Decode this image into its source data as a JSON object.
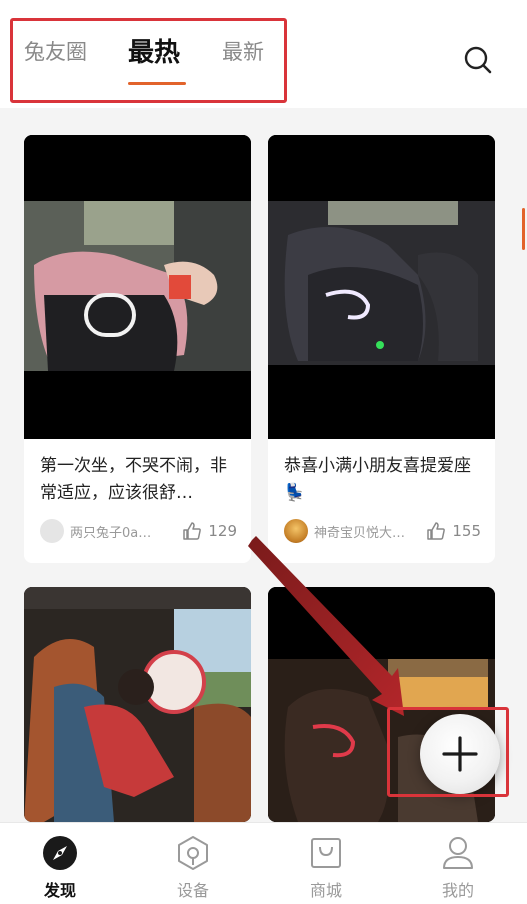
{
  "header": {
    "tabs": [
      {
        "label": "兔友圈",
        "active": false
      },
      {
        "label": "最热",
        "active": true
      },
      {
        "label": "最新",
        "active": false
      }
    ],
    "search_icon": "search-icon",
    "accent_color": "#e2632b"
  },
  "feed": {
    "cards": [
      {
        "title": "第一次坐，不哭不闹，非常适应，应该很舒…",
        "author": "两只兔子0a…",
        "likes": "129"
      },
      {
        "title": "恭喜小满小朋友喜提爱座💺",
        "author": "神奇宝贝悦大…",
        "likes": "155"
      },
      {
        "title": "",
        "author": "",
        "likes": ""
      },
      {
        "title": "",
        "author": "",
        "likes": ""
      }
    ]
  },
  "fab": {
    "icon": "plus-icon"
  },
  "bottom_nav": {
    "items": [
      {
        "label": "发现",
        "icon": "compass-icon",
        "active": true
      },
      {
        "label": "设备",
        "icon": "device-icon",
        "active": false
      },
      {
        "label": "商城",
        "icon": "shopping-bag-icon",
        "active": false
      },
      {
        "label": "我的",
        "icon": "user-icon",
        "active": false
      }
    ]
  },
  "annotation_color": "#d9343a"
}
